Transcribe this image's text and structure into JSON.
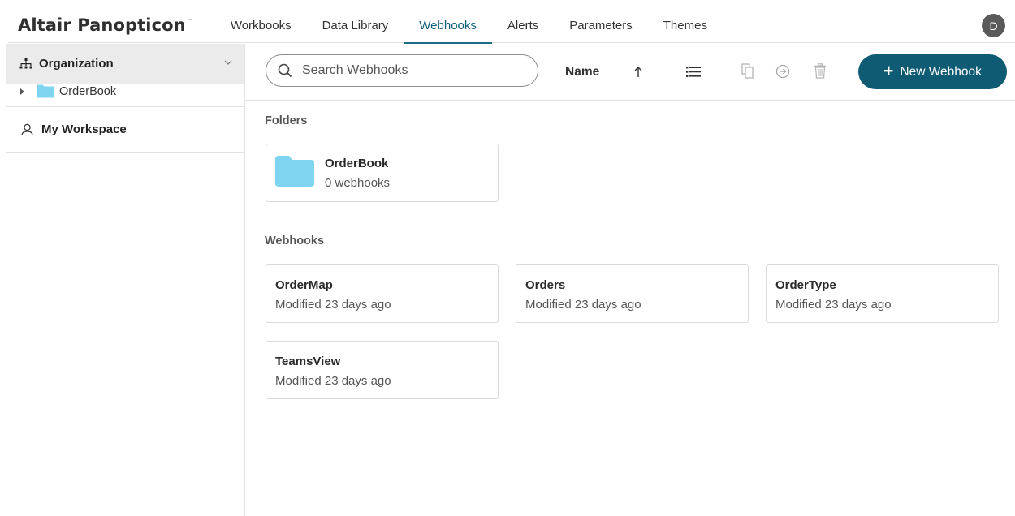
{
  "app": {
    "brand": "Altair Panopticon",
    "brand_tm": "™"
  },
  "nav": {
    "tabs": [
      {
        "label": "Workbooks"
      },
      {
        "label": "Data Library"
      },
      {
        "label": "Webhooks"
      },
      {
        "label": "Alerts"
      },
      {
        "label": "Parameters"
      },
      {
        "label": "Themes"
      }
    ],
    "active_tab": "Webhooks"
  },
  "user": {
    "initial": "D"
  },
  "sidebar": {
    "organization_label": "Organization",
    "tree": [
      {
        "label": "OrderBook",
        "icon": "folder-icon"
      }
    ],
    "workspace_label": "My Workspace"
  },
  "toolbar": {
    "search_placeholder": "Search Webhooks",
    "sort_field": "Name",
    "sort_direction_icon": "arrow-up-icon",
    "new_button_label": "New Webhook"
  },
  "folders": {
    "title": "Folders",
    "items": [
      {
        "name": "OrderBook",
        "meta": "0 webhooks"
      }
    ]
  },
  "webhooks": {
    "title": "Webhooks",
    "items": [
      {
        "name": "OrderMap",
        "meta": "Modified 23 days ago"
      },
      {
        "name": "Orders",
        "meta": "Modified 23 days ago"
      },
      {
        "name": "OrderType",
        "meta": "Modified 23 days ago"
      },
      {
        "name": "TeamsView",
        "meta": "Modified 23 days ago"
      }
    ]
  },
  "colors": {
    "accent": "#0f5b74",
    "folder": "#7fd4f0",
    "sidebar_selected_bg": "#ebebeb"
  }
}
